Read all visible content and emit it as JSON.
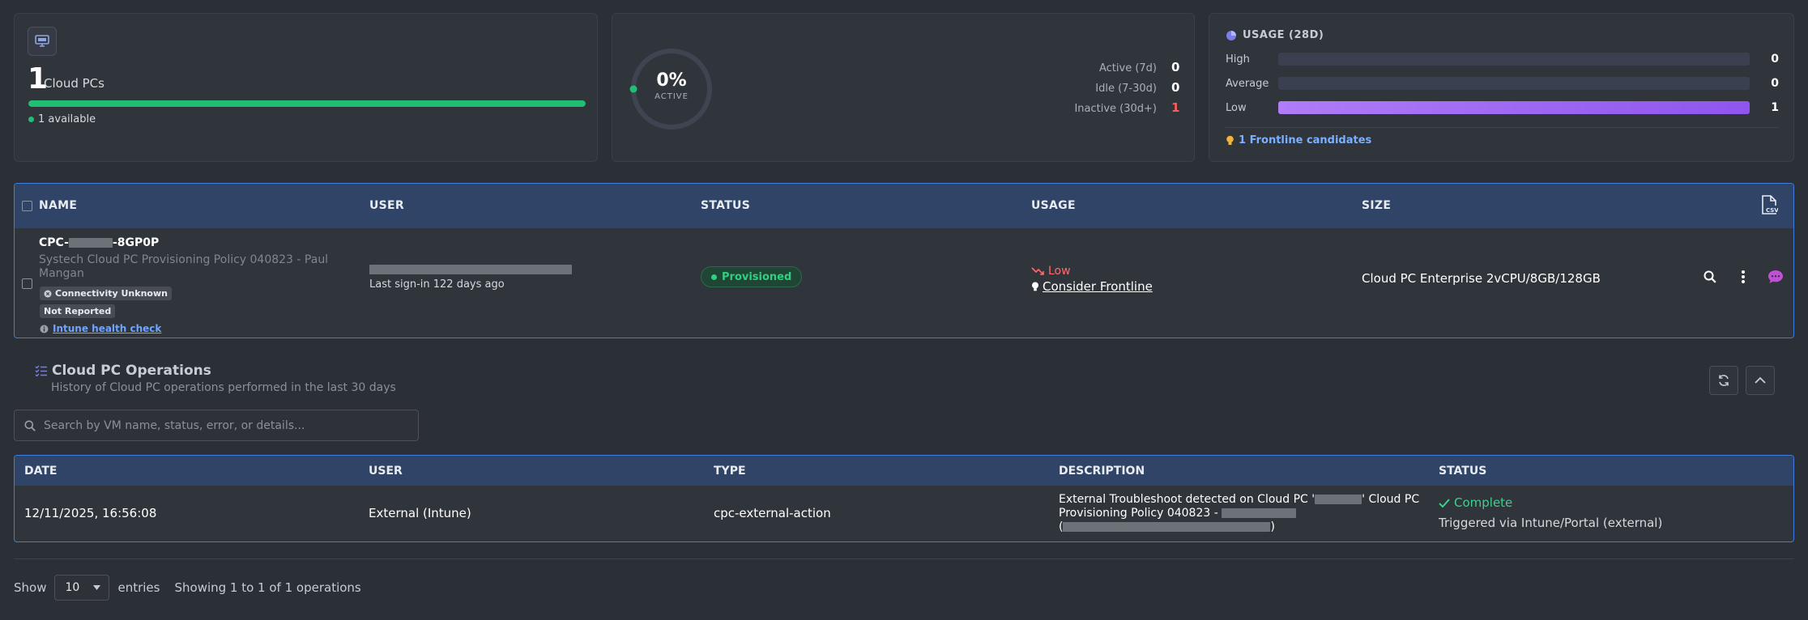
{
  "summary": {
    "count": "1",
    "count_label": "Cloud PCs",
    "available": "1 available",
    "available_fraction": 1.0
  },
  "activity": {
    "percent": "0%",
    "percent_label": "ACTIVE",
    "stats": [
      {
        "label": "Active (7d)",
        "value": "0"
      },
      {
        "label": "Idle (7-30d)",
        "value": "0"
      },
      {
        "label": "Inactive (30d+)",
        "value": "1"
      }
    ]
  },
  "usage": {
    "title": "USAGE (28D)",
    "rows": [
      {
        "label": "High",
        "value": "0",
        "fraction": 0
      },
      {
        "label": "Average",
        "value": "0",
        "fraction": 0
      },
      {
        "label": "Low",
        "value": "1",
        "fraction": 1
      }
    ],
    "frontline": "1 Frontline candidates"
  },
  "pc_table": {
    "headers": {
      "name": "NAME",
      "user": "USER",
      "status": "STATUS",
      "usage": "USAGE",
      "size": "SIZE"
    },
    "row": {
      "name_prefix": "CPC-",
      "name_suffix": "-8GP0P",
      "policy": "Systech Cloud PC Provisioning Policy 040823 - Paul Mangan",
      "connectivity": "Connectivity Unknown",
      "reported": "Not Reported",
      "health_link": "Intune health check",
      "last_signin": "Last sign-in 122 days ago",
      "status": "Provisioned",
      "usage": "Low",
      "consider": "Consider Frontline",
      "size": "Cloud PC Enterprise 2vCPU/8GB/128GB"
    }
  },
  "operations": {
    "title": "Cloud PC Operations",
    "subtitle": "History of Cloud PC operations performed in the last 30 days",
    "search_placeholder": "Search by VM name, status, error, or details...",
    "headers": {
      "date": "DATE",
      "user": "USER",
      "type": "TYPE",
      "description": "DESCRIPTION",
      "status": "STATUS"
    },
    "row": {
      "date": "12/11/2025, 16:56:08",
      "user": "External (Intune)",
      "type": "cpc-external-action",
      "desc_1a": "External Troubleshoot detected on Cloud PC '",
      "desc_1b": "' Cloud PC",
      "desc_2": "Provisioning Policy 040823 -",
      "desc_3a": "(",
      "desc_3b": ")",
      "status": "Complete",
      "triggered": "Triggered via Intune/Portal (external)"
    }
  },
  "footer": {
    "show": "Show",
    "page_size": "10",
    "entries": "entries",
    "info": "Showing 1 to 1 of 1 operations"
  },
  "colors": {
    "accent": "#3f7be0",
    "success": "#1fbf75",
    "danger": "#ff5b5b",
    "usage_low": "#9b63f2"
  }
}
